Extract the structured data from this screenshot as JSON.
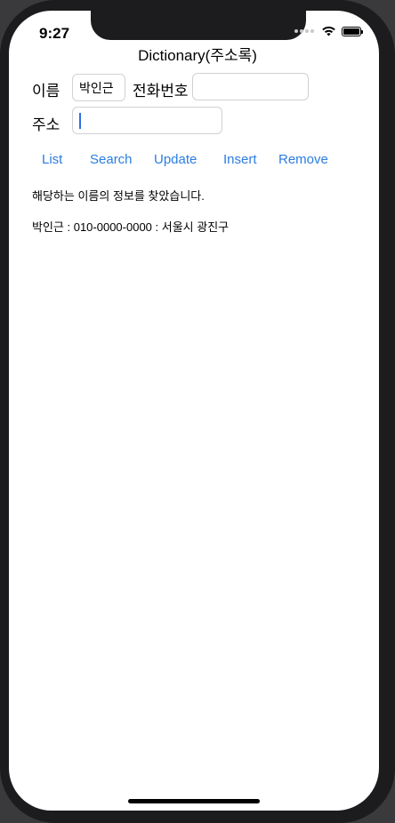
{
  "status_bar": {
    "time": "9:27",
    "icons": [
      "signal-dots-icon",
      "wifi-icon",
      "battery-icon"
    ]
  },
  "nav": {
    "title": "Dictionary(주소록)"
  },
  "form": {
    "name_label": "이름",
    "name_value": "박인근",
    "phone_label": "전화번호",
    "phone_value": "",
    "address_label": "주소",
    "address_value": ""
  },
  "buttons": {
    "list": "List",
    "search": "Search",
    "update": "Update",
    "insert": "Insert",
    "remove": "Remove"
  },
  "result": {
    "status_message": "해당하는 이름의 정보를 찾았습니다.",
    "record": "박인근 : 010-0000-0000 : 서울시 광진구"
  },
  "colors": {
    "accent": "#2a7de1",
    "cursor": "#2f6fe4",
    "field_border": "#d1d1d6"
  }
}
